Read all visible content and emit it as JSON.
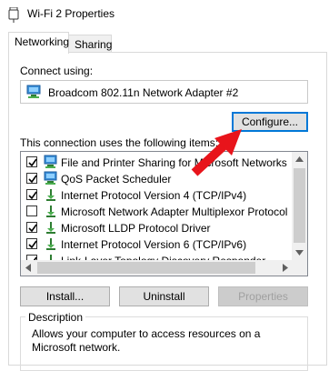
{
  "window": {
    "title": "Wi-Fi 2 Properties",
    "icon": "network-adapter-icon"
  },
  "tabs": [
    {
      "label": "Networking",
      "active": true
    },
    {
      "label": "Sharing",
      "active": false
    }
  ],
  "connect_using": {
    "label": "Connect using:",
    "adapter_name": "Broadcom 802.11n Network Adapter #2",
    "configure_label": "Configure..."
  },
  "items_label": "This connection uses the following items:",
  "items": [
    {
      "label": "File and Printer Sharing for Microsoft Networks",
      "checked": true,
      "icon": "network-computer-icon"
    },
    {
      "label": "QoS Packet Scheduler",
      "checked": true,
      "icon": "network-computer-icon"
    },
    {
      "label": "Internet Protocol Version 4 (TCP/IPv4)",
      "checked": true,
      "icon": "protocol-icon"
    },
    {
      "label": "Microsoft Network Adapter Multiplexor Protocol",
      "checked": false,
      "icon": "protocol-icon"
    },
    {
      "label": "Microsoft LLDP Protocol Driver",
      "checked": true,
      "icon": "protocol-icon"
    },
    {
      "label": "Internet Protocol Version 6 (TCP/IPv6)",
      "checked": true,
      "icon": "protocol-icon"
    },
    {
      "label": "Link-Layer Topology Discovery Responder",
      "checked": true,
      "icon": "protocol-icon"
    }
  ],
  "buttons": {
    "install": "Install...",
    "uninstall": "Uninstall",
    "properties": "Properties"
  },
  "description": {
    "title": "Description",
    "text": "Allows your computer to access resources on a Microsoft network."
  },
  "colors": {
    "accent": "#0078d7",
    "annotation_arrow": "#e8141b"
  }
}
